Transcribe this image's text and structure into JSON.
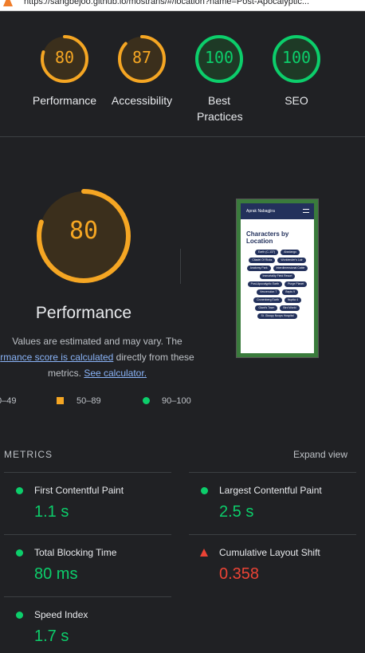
{
  "browser": {
    "url": "https://sangbejoo.github.io/mostrans/#/location?name=Post-Apocalyptic..."
  },
  "summary": {
    "gauges": [
      {
        "score": "80",
        "label": "Performance",
        "color": "#f5a623",
        "fraction": 0.8
      },
      {
        "score": "87",
        "label": "Accessibility",
        "color": "#f5a623",
        "fraction": 0.87
      },
      {
        "score": "100",
        "label": "Best Practices",
        "color": "#0cce6b",
        "fraction": 1.0
      },
      {
        "score": "100",
        "label": "SEO",
        "color": "#0cce6b",
        "fraction": 1.0
      }
    ]
  },
  "performance": {
    "score": "80",
    "fraction": 0.8,
    "title": "Performance",
    "desc_line1": "Values are estimated and may vary. The",
    "desc_link1": "rmance score is calculated",
    "desc_after_link1": " directly from these",
    "desc_line3": "metrics. ",
    "desc_link2": "See calculator."
  },
  "screenshot": {
    "header": "Aprak Nabagjira",
    "title": "Characters by Location",
    "chips": [
      "Earth (C-137)",
      "Abadango",
      "Citadel Of Ricks",
      "Worldender's Lair",
      "Anatomy Park",
      "Interdimensional Cable",
      "Immortality Field Resort",
      "Post-Apocalyptic Earth",
      "Purge Planet",
      "Venzenulon 7",
      "Bepis 9",
      "Cronenberg Earth",
      "Nuptia 4",
      "Giant's Town",
      "Bird World",
      "St. Gloopy Noops Hospital"
    ]
  },
  "legend": {
    "range_low": "0–49",
    "range_mid": "50–89",
    "range_high": "90–100",
    "color_mid": "#f5a623",
    "color_high": "#0cce6b"
  },
  "metrics": {
    "title": "METRICS",
    "expand_label": "Expand view",
    "items": [
      {
        "label": "First Contentful Paint",
        "value": "1.1 s",
        "status": "pass"
      },
      {
        "label": "Largest Contentful Paint",
        "value": "2.5 s",
        "status": "pass"
      },
      {
        "label": "Total Blocking Time",
        "value": "80 ms",
        "status": "pass"
      },
      {
        "label": "Cumulative Layout Shift",
        "value": "0.358",
        "status": "fail"
      },
      {
        "label": "Speed Index",
        "value": "1.7 s",
        "status": "pass"
      }
    ]
  }
}
